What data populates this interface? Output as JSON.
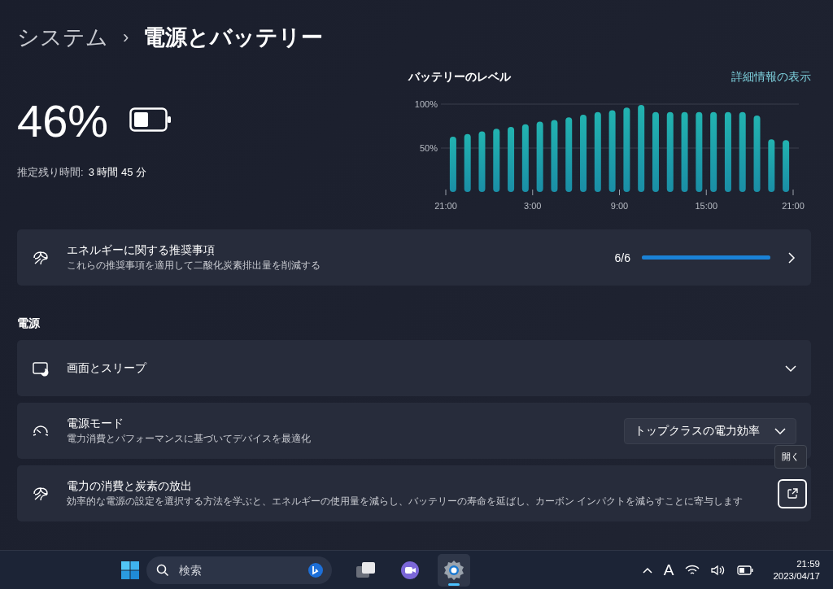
{
  "breadcrumb": {
    "parent": "システム",
    "separator": "›",
    "current": "電源とバッテリー"
  },
  "battery": {
    "percent": "46%",
    "estimate_label": "推定残り時間:",
    "estimate_value": "3 時間 45 分"
  },
  "battery_chart": {
    "link": "詳細情報の表示",
    "chart_data": {
      "type": "bar",
      "title": "バッテリーのレベル",
      "categories": [
        "21:00",
        null,
        null,
        null,
        null,
        null,
        "3:00",
        null,
        null,
        null,
        null,
        null,
        "9:00",
        null,
        null,
        null,
        null,
        null,
        "15:00",
        null,
        null,
        null,
        null,
        null,
        "21:00"
      ],
      "values": [
        63,
        66,
        69,
        72,
        74,
        77,
        80,
        82,
        85,
        88,
        91,
        93,
        96,
        99,
        91,
        91,
        91,
        91,
        91,
        91,
        91,
        87,
        60,
        59,
        null
      ],
      "ylim": [
        0,
        100
      ],
      "yticks": [
        {
          "value": 50,
          "label": "50%"
        },
        {
          "value": 100,
          "label": "100%"
        }
      ]
    }
  },
  "recommendations": {
    "title": "エネルギーに関する推奨事項",
    "subtitle": "これらの推奨事項を適用して二酸化炭素排出量を削減する",
    "count": "6/6",
    "level": 1
  },
  "section_title": "電源",
  "settings": [
    {
      "kind": "expander",
      "title": "画面とスリープ",
      "expanded": false
    },
    {
      "kind": "dropdown",
      "title": "電源モード",
      "subtitle": "電力消費とパフォーマンスに基づいてデバイスを最適化",
      "value": "トップクラスの電力効率"
    },
    {
      "kind": "link",
      "title": "電力の消費と炭素の放出",
      "subtitle": "効率的な電源の設定を選択する方法を学ぶと、エネルギーの使用量を減らし、バッテリーの寿命を延ばし、カーボン インパクトを減らすことに寄与します",
      "tooltip": "開く"
    }
  ],
  "taskbar": {
    "search_placeholder": "検索",
    "apps": [
      {
        "kind": "taskview",
        "selected": false
      },
      {
        "kind": "meet",
        "selected": false
      },
      {
        "kind": "settings",
        "selected": true
      }
    ],
    "ime": "A",
    "time": "21:59",
    "date": "2023/04/17"
  }
}
